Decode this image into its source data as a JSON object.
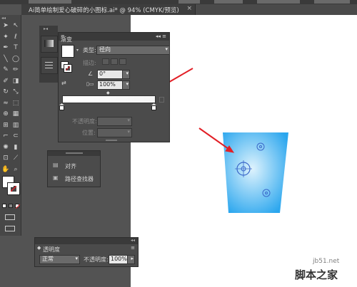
{
  "app": {
    "document_tab_title": "Ai简单绘制爱心破碎的小图标.ai* @ 94% (CMYK/预览)",
    "document_tab_close": "×"
  },
  "toolbar": {
    "collapse_glyph": "◂◂",
    "tools": [
      "selection-tool",
      "direct-selection-tool",
      "magic-wand-tool",
      "lasso-tool",
      "pen-tool",
      "type-tool",
      "line-tool",
      "ellipse-tool",
      "paintbrush-tool",
      "pencil-tool",
      "blob-brush-tool",
      "eraser-tool",
      "rotate-tool",
      "scale-tool",
      "warp-tool",
      "free-transform-tool",
      "shape-builder-tool",
      "perspective-grid-tool",
      "mesh-tool",
      "gradient-tool",
      "eyedropper-tool",
      "blend-tool",
      "symbol-sprayer-tool",
      "column-graph-tool",
      "artboard-tool",
      "slice-tool",
      "hand-tool",
      "zoom-tool"
    ]
  },
  "gradient_panel": {
    "title": "渐变",
    "type_label": "类型:",
    "type_value": "径向",
    "stroke_label": "描边:",
    "angle_value": "0°",
    "aspect_value": "100%",
    "opacity_label": "不透明度:",
    "location_label": "位置:",
    "stop_colors": [
      "#ffffff",
      "#ffffff"
    ],
    "gradient_from": "#ffffff",
    "gradient_to": "#f4f4f4"
  },
  "align_panel": {
    "items": [
      {
        "label": "对齐",
        "icon": "align-icon"
      },
      {
        "label": "路径查找器",
        "icon": "pathfinder-icon"
      }
    ]
  },
  "transparency_panel": {
    "title": "透明度",
    "blend_mode": "正常",
    "opacity_label": "不透明度:",
    "opacity_value": "100%"
  },
  "artwork": {
    "cup_fill_center": "#dff3fd",
    "cup_fill_edge": "#2aa6ee",
    "arrow_color": "#e21f26",
    "gradient_annotator_color": "#3a67c9"
  },
  "watermark": {
    "site": "jb51.net",
    "name": "脚本之家"
  }
}
